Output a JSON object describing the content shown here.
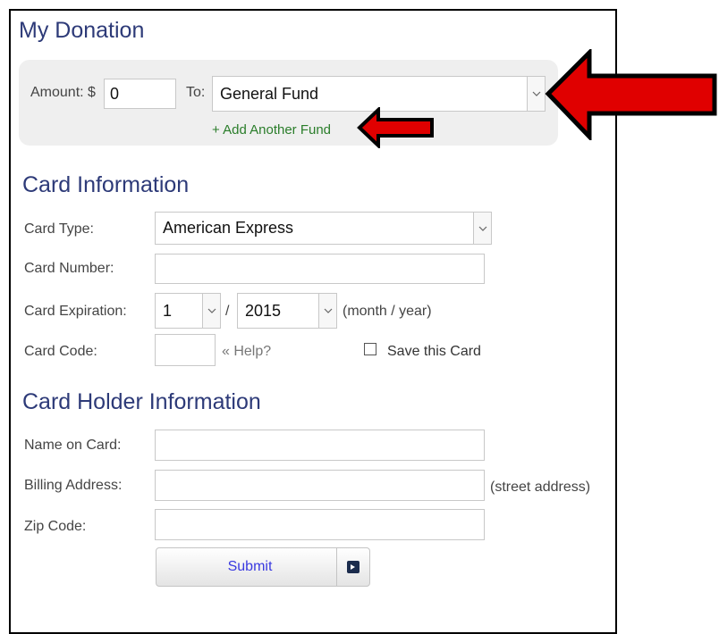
{
  "donation": {
    "title": "My Donation",
    "amount_label": "Amount: $",
    "amount_value": "0",
    "to_label": "To:",
    "fund_selected": "General Fund",
    "add_fund_link": "+ Add Another Fund"
  },
  "card_info": {
    "title": "Card Information",
    "type_label": "Card Type:",
    "type_selected": "American Express",
    "number_label": "Card Number:",
    "number_value": "",
    "expiration_label": "Card Expiration:",
    "exp_month": "1",
    "exp_separator": "/",
    "exp_year": "2015",
    "exp_hint": "(month / year)",
    "code_label": "Card Code:",
    "code_value": "",
    "help_link": "« Help?",
    "save_card_label": "Save this Card",
    "save_card_checked": false
  },
  "holder_info": {
    "title": "Card Holder Information",
    "name_label": "Name on Card:",
    "name_value": "",
    "address_label": "Billing Address:",
    "address_value": "",
    "address_hint": "(street address)",
    "zip_label": "Zip Code:",
    "zip_value": ""
  },
  "submit": {
    "label": "Submit",
    "icon": "arrow-right-square-icon"
  },
  "annotations": {
    "arrow_color": "#e00000",
    "arrow_outline": "#000000"
  },
  "colors": {
    "heading": "#2d3a78",
    "link_green": "#2a7d2a",
    "submit_text": "#3a3ae0",
    "panel_bg": "#efefef"
  }
}
